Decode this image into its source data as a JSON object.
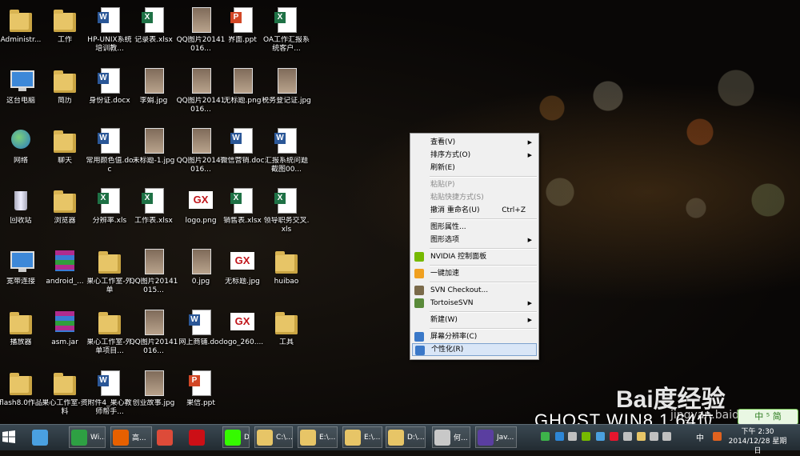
{
  "desktop_icons": [
    {
      "label": "Administr...",
      "type": "user"
    },
    {
      "label": "工作",
      "type": "folder"
    },
    {
      "label": "HP-UNIX系统培训教...",
      "type": "word"
    },
    {
      "label": "记录表.xlsx",
      "type": "excel"
    },
    {
      "label": "QQ图片20141016...",
      "type": "image"
    },
    {
      "label": "界面.ppt",
      "type": "ppt"
    },
    {
      "label": "OA工作汇报系统客户...",
      "type": "excel"
    },
    {
      "label": "这台电脑",
      "type": "computer"
    },
    {
      "label": "简历",
      "type": "folder"
    },
    {
      "label": "身份证.docx",
      "type": "word"
    },
    {
      "label": "李娟.jpg",
      "type": "image"
    },
    {
      "label": "QQ图片20141016...",
      "type": "image"
    },
    {
      "label": "无标题.png",
      "type": "image"
    },
    {
      "label": "税务登记证.jpg",
      "type": "image"
    },
    {
      "label": "网络",
      "type": "network"
    },
    {
      "label": "聊天",
      "type": "folder"
    },
    {
      "label": "常用颜色值.doc",
      "type": "word"
    },
    {
      "label": "未标题-1.jpg",
      "type": "image"
    },
    {
      "label": "QQ图片20141016...",
      "type": "image"
    },
    {
      "label": "微信营销.doc",
      "type": "word"
    },
    {
      "label": "汇报系统问题截图00...",
      "type": "word"
    },
    {
      "label": "回收站",
      "type": "recycle"
    },
    {
      "label": "浏览器",
      "type": "folder"
    },
    {
      "label": "分辨率.xls",
      "type": "excel"
    },
    {
      "label": "工作表.xlsx",
      "type": "excel"
    },
    {
      "label": "logo.png",
      "type": "gx"
    },
    {
      "label": "销售表.xlsx",
      "type": "excel"
    },
    {
      "label": "领导职务交叉.xls",
      "type": "excel"
    },
    {
      "label": "宽带连接",
      "type": "computer"
    },
    {
      "label": "android_...",
      "type": "rar"
    },
    {
      "label": "果心工作室-外单",
      "type": "folder"
    },
    {
      "label": "QQ图片20141015...",
      "type": "image"
    },
    {
      "label": "0.jpg",
      "type": "image"
    },
    {
      "label": "无标题.jpg",
      "type": "gx"
    },
    {
      "label": "huibao",
      "type": "folder"
    },
    {
      "label": "播放器",
      "type": "folder"
    },
    {
      "label": "asm.jar",
      "type": "rar"
    },
    {
      "label": "果心工作室-外单项目...",
      "type": "folder"
    },
    {
      "label": "QQ图片20141016...",
      "type": "image"
    },
    {
      "label": "网上商铺.doc",
      "type": "word"
    },
    {
      "label": "logo_260....",
      "type": "gx"
    },
    {
      "label": "工具",
      "type": "folder"
    },
    {
      "label": "flash8.0作品",
      "type": "folder"
    },
    {
      "label": "果心工作室-资料",
      "type": "folder"
    },
    {
      "label": "附件4_果心教师帮手...",
      "type": "word"
    },
    {
      "label": "创业故事.jpg",
      "type": "image"
    },
    {
      "label": "果信.ppt",
      "type": "ppt"
    }
  ],
  "context_menu": {
    "items": [
      {
        "label": "查看(V)",
        "submenu": true
      },
      {
        "label": "排序方式(O)",
        "submenu": true
      },
      {
        "label": "刷新(E)"
      },
      {
        "separator": true
      },
      {
        "label": "粘贴(P)",
        "disabled": true
      },
      {
        "label": "粘贴快捷方式(S)",
        "disabled": true
      },
      {
        "label": "撤消 重命名(U)",
        "shortcut": "Ctrl+Z"
      },
      {
        "separator": true
      },
      {
        "label": "图形属性..."
      },
      {
        "label": "图形选项",
        "submenu": true
      },
      {
        "separator": true
      },
      {
        "label": "NVIDIA 控制面板",
        "icon": "nvidia-icon",
        "icon_color": "#76b900"
      },
      {
        "separator": true
      },
      {
        "label": "一键加速",
        "icon": "speedup-icon",
        "icon_color": "#f0a020"
      },
      {
        "separator": true
      },
      {
        "label": "SVN Checkout...",
        "icon": "svn-checkout-icon",
        "icon_color": "#7a6a4a"
      },
      {
        "label": "TortoiseSVN",
        "icon": "tortoise-icon",
        "icon_color": "#5a8a3a",
        "submenu": true
      },
      {
        "separator": true
      },
      {
        "label": "新建(W)",
        "submenu": true
      },
      {
        "separator": true
      },
      {
        "label": "屏幕分辨率(C)",
        "icon": "display-icon",
        "icon_color": "#3a78c8"
      },
      {
        "label": "个性化(R)",
        "icon": "personalize-icon",
        "icon_color": "#3a78c8",
        "highlighted": true
      }
    ]
  },
  "taskbar": {
    "buttons": [
      {
        "name": "start-button",
        "label": "",
        "color": "#ffffff"
      },
      {
        "name": "pinned-qq",
        "label": "",
        "color": "#4aa0e0"
      },
      {
        "name": "task-wi",
        "label": "Wi...",
        "color": "#2ea043"
      },
      {
        "name": "task-firefox",
        "label": "高...",
        "color": "#e66000"
      },
      {
        "name": "pinned-chrome",
        "label": "",
        "color": "#dd4b39"
      },
      {
        "name": "pinned-opera",
        "label": "",
        "color": "#cc0f16"
      },
      {
        "name": "pinned-dreamweaver",
        "label": "Dw",
        "color": "#35fa00"
      },
      {
        "name": "task-explorer-c",
        "label": "C:\\...",
        "color": "#e7c567"
      },
      {
        "name": "task-explorer-e1",
        "label": "E:\\...",
        "color": "#e7c567"
      },
      {
        "name": "task-explorer-e2",
        "label": "E:\\...",
        "color": "#e7c567"
      },
      {
        "name": "task-explorer-d",
        "label": "D:\\...",
        "color": "#e7c567"
      },
      {
        "name": "task-app-he",
        "label": "何...",
        "color": "#c8c8c8"
      },
      {
        "name": "task-java",
        "label": "Jav...",
        "color": "#5a3ea0"
      }
    ],
    "tray_icons": [
      {
        "name": "security-tray-icon",
        "color": "#3db34a"
      },
      {
        "name": "shield-tray-icon",
        "color": "#2d86d6"
      },
      {
        "name": "speaker-tray-icon",
        "color": "#c0c0c0"
      },
      {
        "name": "nvidia-tray-icon",
        "color": "#76b900"
      },
      {
        "name": "monitor-tray-icon",
        "color": "#4aa0e0"
      },
      {
        "name": "weibo-tray-icon",
        "color": "#e6162d"
      },
      {
        "name": "flag-tray-icon",
        "color": "#c0c0c0"
      },
      {
        "name": "folder-tray-icon",
        "color": "#e7c567"
      },
      {
        "name": "network-tray-icon",
        "color": "#c0c0c0"
      },
      {
        "name": "volume-tray-icon",
        "color": "#c0c0c0"
      },
      {
        "name": "sogou-tray-icon",
        "color": "#e0621f"
      }
    ],
    "ime_label": "中",
    "clock_time": "下午 2:30",
    "clock_date": "2014/12/28 星期日"
  },
  "watermark": "GHOST WIN8.1 64位",
  "baidu_logo": "Bai度经验",
  "baidu_url": "jingyan.baidu.com",
  "ime_float": "中 ⁵ 简"
}
